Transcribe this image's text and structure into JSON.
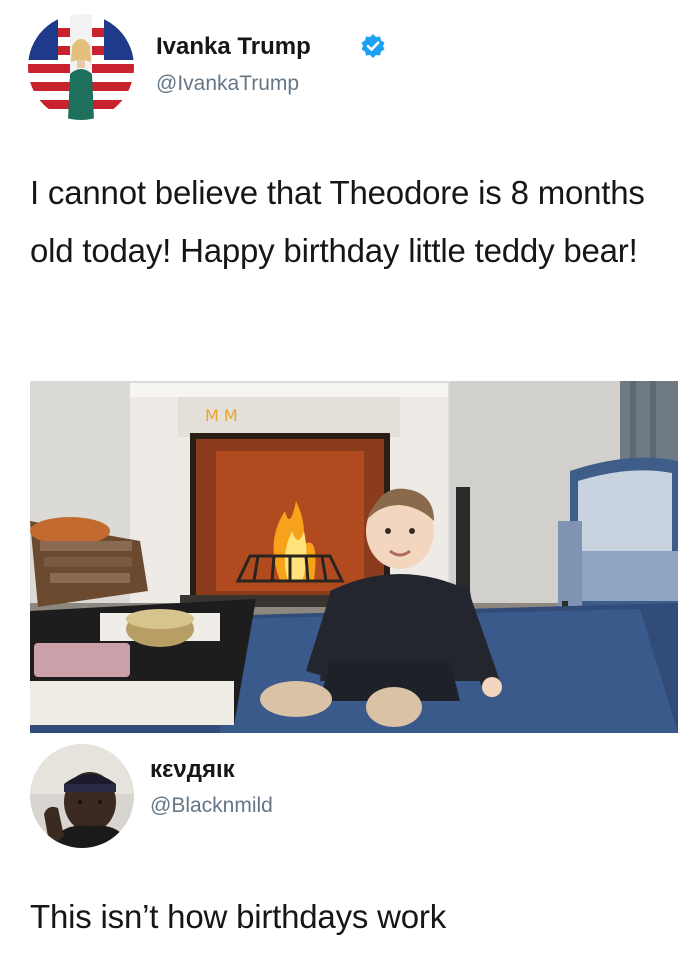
{
  "tweets": [
    {
      "author": {
        "name": "Ivanka Trump",
        "handle": "@IvankaTrump",
        "verified": true,
        "verified_color": "#1da1f2",
        "avatar_icon": "avatar-photo-flags"
      },
      "text": "I cannot believe that Theodore is 8 months old today! Happy birthday little teddy bear!",
      "media": {
        "icon": "photo-baby-fireplace"
      }
    },
    {
      "author": {
        "name": "кενдяιк",
        "handle": "@Blacknmild",
        "avatar_icon": "avatar-photo-man"
      },
      "text": "This isn’t how birthdays work"
    }
  ],
  "colors": {
    "text": "#14171a",
    "handle": "#657786",
    "verified": "#1da1f2"
  }
}
